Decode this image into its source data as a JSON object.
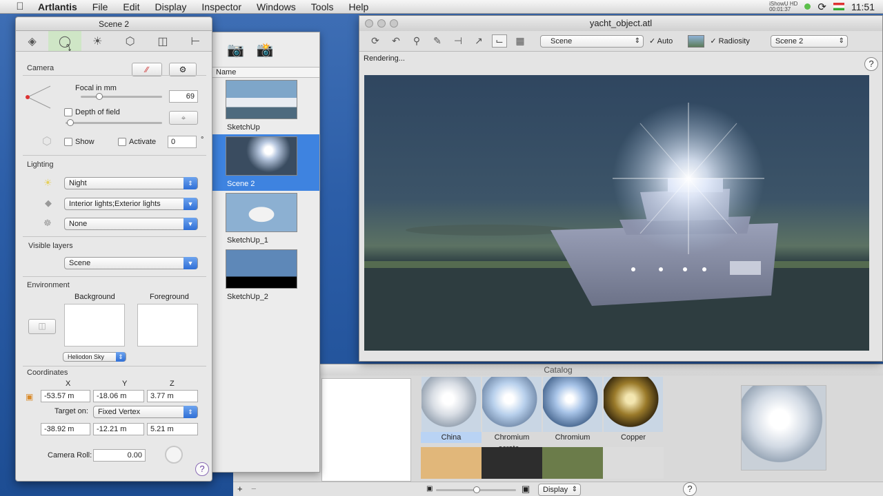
{
  "menubar": {
    "app": "Artlantis",
    "items": [
      "File",
      "Edit",
      "Display",
      "Inspector",
      "Windows",
      "Tools",
      "Help"
    ],
    "recording_line1": "iShowU HD",
    "recording_line2": "00:01:37",
    "time": "11:51"
  },
  "inspector": {
    "title": "Scene 2",
    "camera": {
      "label": "Camera",
      "focal_label": "Focal in mm",
      "focal_value": "69",
      "focal_level_fraction": 0.22,
      "depth_of_field_label": "Depth of field",
      "show_label": "Show",
      "activate_label": "Activate",
      "angle_value": "0",
      "degree_symbol": "°"
    },
    "lighting": {
      "label": "Lighting",
      "sun_value": "Night",
      "lights_value": "Interior lights;Exterior lights",
      "heliodon_value": "None"
    },
    "visible_layers": {
      "label": "Visible layers",
      "value": "Scene"
    },
    "environment": {
      "label": "Environment",
      "background_label": "Background",
      "foreground_label": "Foreground",
      "sky_value": "Heliodon Sky"
    },
    "coordinates": {
      "label": "Coordinates",
      "x_label": "X",
      "y_label": "Y",
      "z_label": "Z",
      "x": "-53.57 m",
      "y": "-18.06 m",
      "z": "3.77 m",
      "target_label": "Target on:",
      "target_value": "Fixed Vertex",
      "tx": "-38.92 m",
      "ty": "-12.21 m",
      "tz": "5.21 m",
      "roll_label": "Camera Roll:",
      "roll_value": "0.00"
    },
    "help": "?"
  },
  "scenes": {
    "column_name": "Name",
    "items": [
      {
        "name": "SketchUp"
      },
      {
        "name": "Scene 2"
      },
      {
        "name": "SketchUp_1"
      },
      {
        "name": "SketchUp_2"
      }
    ]
  },
  "render_window": {
    "title": "yacht_object.atl",
    "scene_popup": "Scene",
    "auto_label": "Auto",
    "radiosity_label": "Radiosity",
    "scene2_popup": "Scene 2",
    "status": "Rendering...",
    "help": "?"
  },
  "catalog": {
    "title": "Catalog",
    "materials": [
      {
        "name": "China"
      },
      {
        "name": "Chromium scratc..."
      },
      {
        "name": "Chromium"
      },
      {
        "name": "Copper"
      }
    ],
    "display_label": "Display",
    "help": "?",
    "plus": "+",
    "minus": "−"
  }
}
